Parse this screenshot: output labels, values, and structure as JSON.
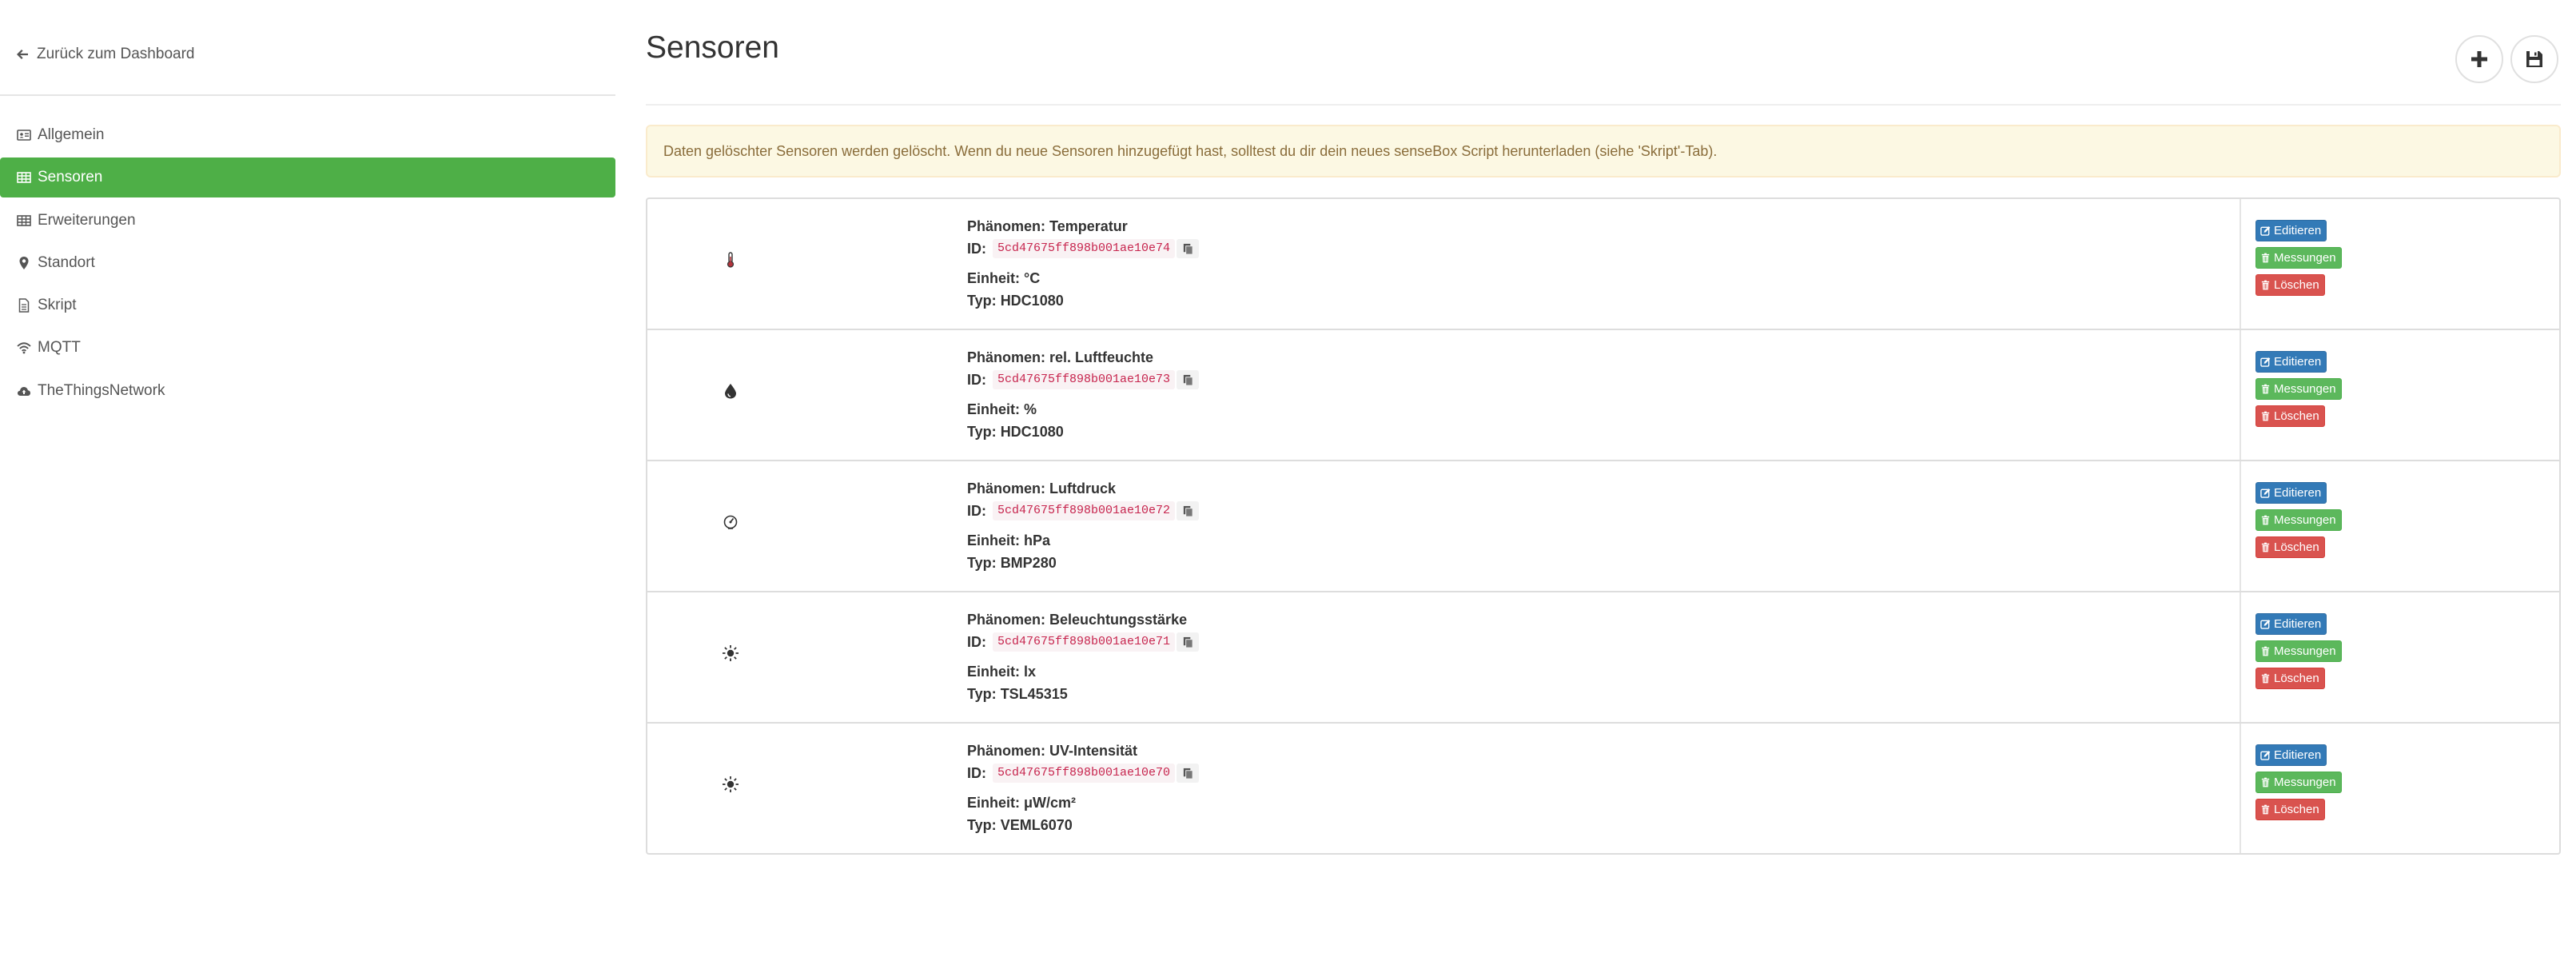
{
  "sidebar": {
    "back_label": "Zurück zum Dashboard",
    "items": [
      {
        "label": "Allgemein",
        "icon": "id-card-icon"
      },
      {
        "label": "Sensoren",
        "icon": "table-icon",
        "active": true
      },
      {
        "label": "Erweiterungen",
        "icon": "table-icon"
      },
      {
        "label": "Standort",
        "icon": "map-marker-icon"
      },
      {
        "label": "Skript",
        "icon": "file-icon"
      },
      {
        "label": "MQTT",
        "icon": "wifi-icon"
      },
      {
        "label": "TheThingsNetwork",
        "icon": "cloud-upload-icon"
      }
    ]
  },
  "header": {
    "title": "Sensoren",
    "add_icon": "plus-icon",
    "save_icon": "floppy-disk-icon"
  },
  "alert": {
    "text": "Daten gelöschter Sensoren werden gelöscht. Wenn du neue Sensoren hinzugefügt hast, solltest du dir dein neues senseBox Script herunterladen (siehe 'Skript'-Tab)."
  },
  "labels": {
    "phenomenon": "Phänomen:",
    "id": "ID:",
    "unit": "Einheit:",
    "type": "Typ:",
    "edit": "Editieren",
    "measurements": "Messungen",
    "delete": "Löschen"
  },
  "sensors": [
    {
      "icon": "thermometer-icon",
      "phenomenon": "Temperatur",
      "id": "5cd47675ff898b001ae10e74",
      "unit": "°C",
      "type": "HDC1080"
    },
    {
      "icon": "water-drop-icon",
      "phenomenon": "rel. Luftfeuchte",
      "id": "5cd47675ff898b001ae10e73",
      "unit": "%",
      "type": "HDC1080"
    },
    {
      "icon": "gauge-icon",
      "phenomenon": "Luftdruck",
      "id": "5cd47675ff898b001ae10e72",
      "unit": "hPa",
      "type": "BMP280"
    },
    {
      "icon": "sun-icon",
      "phenomenon": "Beleuchtungsstärke",
      "id": "5cd47675ff898b001ae10e71",
      "unit": "lx",
      "type": "TSL45315"
    },
    {
      "icon": "sun-icon",
      "phenomenon": "UV-Intensität",
      "id": "5cd47675ff898b001ae10e70",
      "unit": "μW/cm²",
      "type": "VEML6070"
    }
  ],
  "colors": {
    "active_nav": "#4eaf47",
    "edit_button": "#337ab7",
    "measurements_button": "#5cb85c",
    "delete_button": "#d9534f",
    "alert_bg": "#fcf8e3",
    "id_text": "#c7254e"
  }
}
